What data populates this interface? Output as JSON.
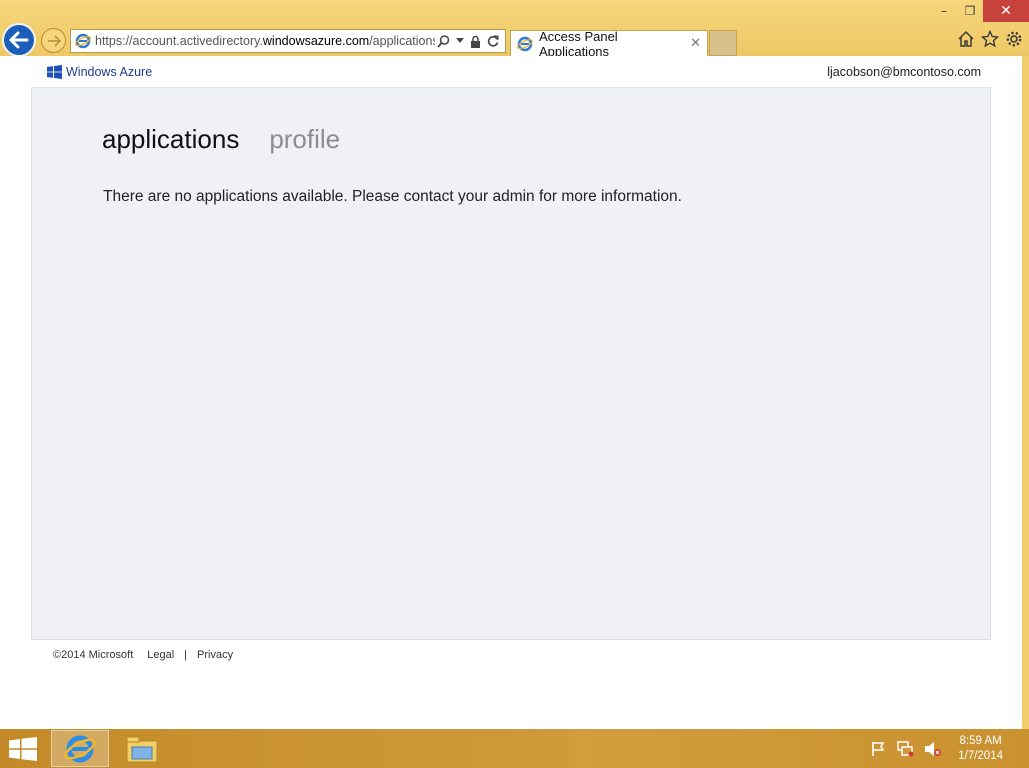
{
  "browser": {
    "url_prefix": "https://account.activedirectory.",
    "url_domain": "windowsazure.com",
    "url_path": "/applications,",
    "tab_title": "Access Panel Applications",
    "caption": {
      "minimize": "–",
      "restore": "❐",
      "close": "✕"
    }
  },
  "header": {
    "brand": "Windows Azure",
    "user": "ljacobson@bmcontoso.com"
  },
  "nav": {
    "active": "applications",
    "inactive": "profile"
  },
  "main": {
    "message": "There are no applications available. Please contact your admin for more information."
  },
  "footer": {
    "copyright": "©2014 Microsoft",
    "legal": "Legal",
    "separator": "|",
    "privacy": "Privacy"
  },
  "taskbar": {
    "time": "8:59 AM",
    "date": "1/7/2014"
  },
  "colors": {
    "chrome": "#f0ce6b",
    "accent": "#1c5fb8",
    "brand": "#1f3b8d",
    "content_bg": "#eff1f6",
    "close_button": "#c7423b"
  }
}
